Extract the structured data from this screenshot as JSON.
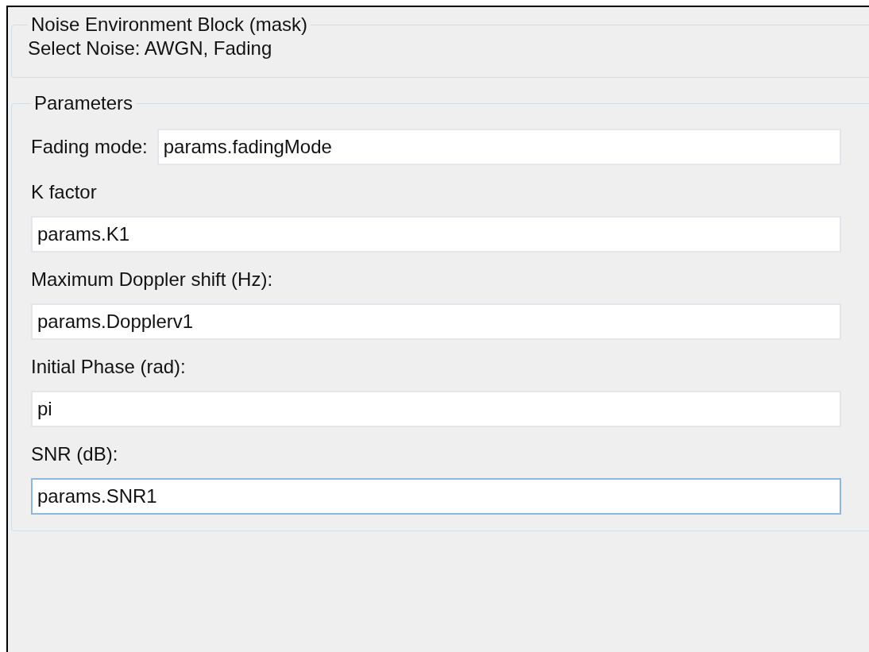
{
  "mask_group": {
    "title": "Noise Environment Block (mask)",
    "description": "Select Noise: AWGN, Fading"
  },
  "parameters_group": {
    "title": "Parameters",
    "fields": [
      {
        "kind": "inline",
        "label": "Fading mode:",
        "value": "params.fadingMode",
        "focused": false
      },
      {
        "kind": "stacked",
        "label": "K factor",
        "value": "params.K1",
        "focused": false
      },
      {
        "kind": "stacked",
        "label": "Maximum Doppler shift (Hz):",
        "value": "params.Dopplerv1",
        "focused": false
      },
      {
        "kind": "stacked",
        "label": "Initial Phase (rad):",
        "value": "pi",
        "focused": false
      },
      {
        "kind": "stacked",
        "label": "SNR (dB):",
        "value": "params.SNR1",
        "focused": true
      }
    ]
  }
}
